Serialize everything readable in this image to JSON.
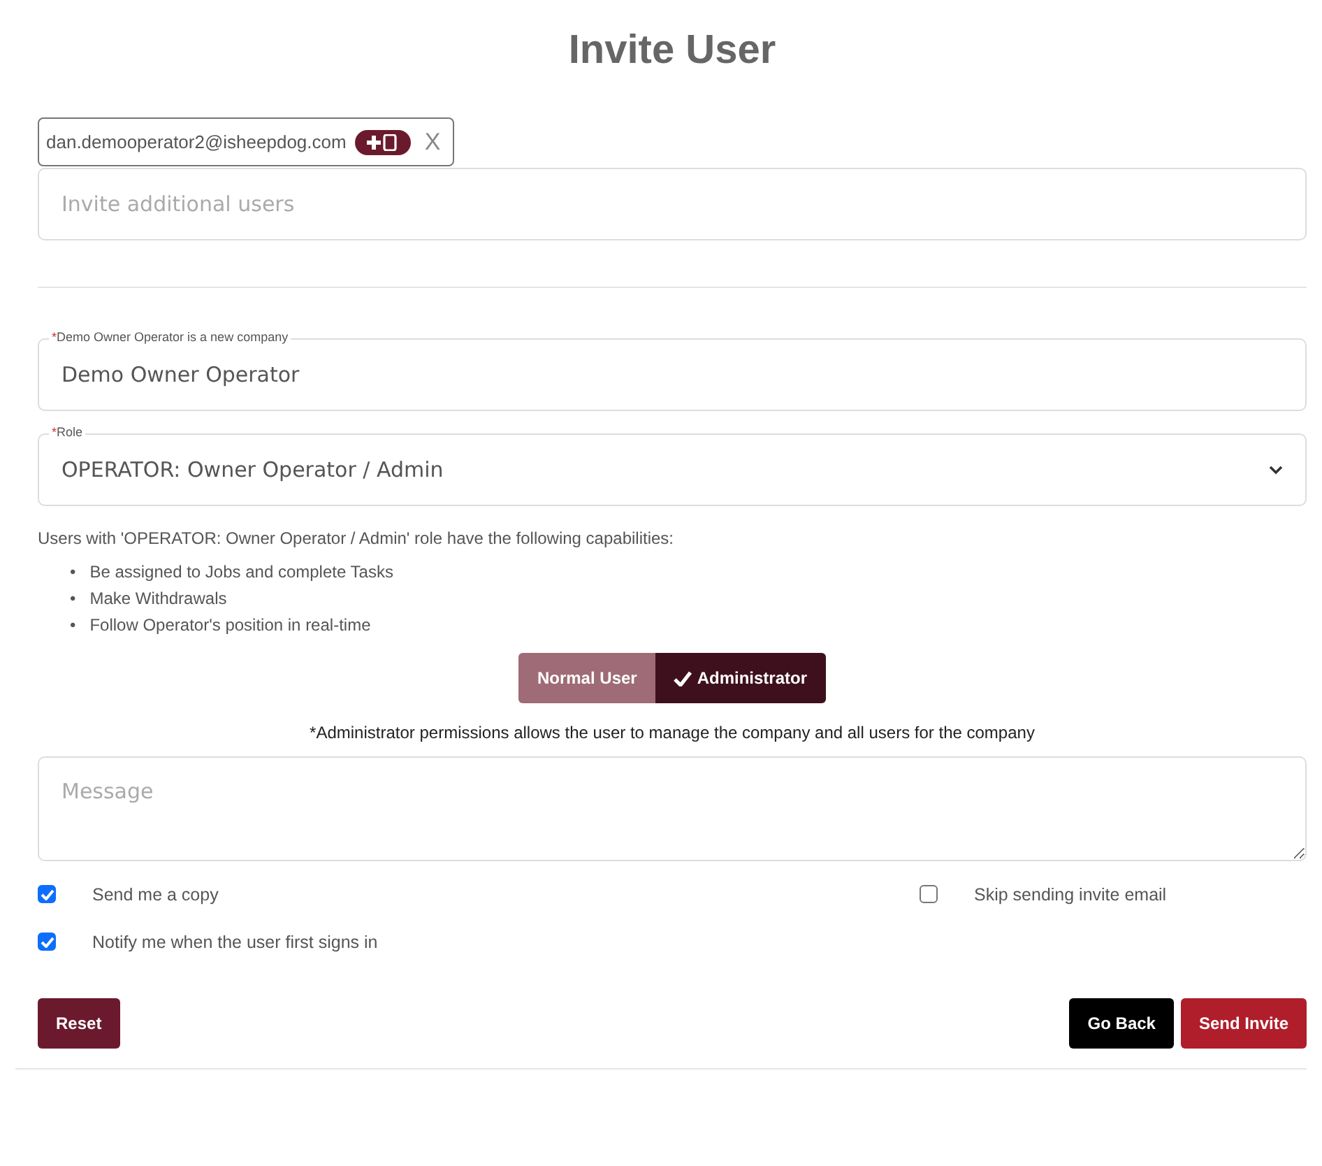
{
  "title": "Invite User",
  "invitees": [
    {
      "email": "dan.demooperator2@isheepdog.com",
      "remove": "X"
    }
  ],
  "invite_field": {
    "placeholder": "Invite additional users"
  },
  "company_field": {
    "label_mark": "*",
    "label": "Demo Owner Operator is a new company",
    "value": "Demo Owner Operator"
  },
  "role_field": {
    "label_mark": "*",
    "label": "Role",
    "value": "OPERATOR: Owner Operator / Admin"
  },
  "capabilities": {
    "bullet": "•",
    "intro": "Users with 'OPERATOR: Owner Operator / Admin' role have the following capabilities:",
    "items": [
      "Be assigned to Jobs and complete Tasks",
      "Make Withdrawals",
      "Follow Operator's position in real-time"
    ]
  },
  "user_type": [
    {
      "label": "Normal User",
      "selected": false
    },
    {
      "label": "Administrator",
      "selected": true
    }
  ],
  "admin_note": "*Administrator permissions allows the user to manage the company and all users for the company",
  "message_field": {
    "placeholder": "Message"
  },
  "options": {
    "left": [
      {
        "label": "Send me a copy",
        "checked": true
      },
      {
        "label": "Notify me when the user first signs in",
        "checked": true
      }
    ],
    "right": [
      {
        "label": "Skip sending invite email",
        "checked": false
      }
    ]
  },
  "buttons": [
    {
      "label": "Reset",
      "kind": "reset"
    },
    {
      "label": "Go Back",
      "kind": "back"
    },
    {
      "label": "Send Invite",
      "kind": "primary"
    }
  ]
}
